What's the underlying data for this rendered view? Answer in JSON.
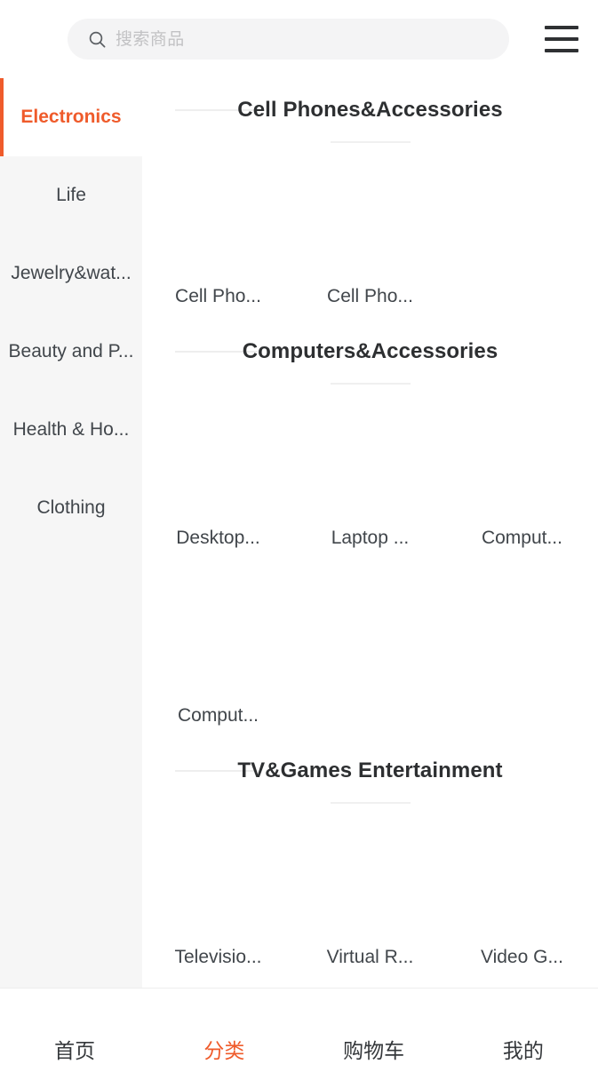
{
  "theme": {
    "accent": "#ef5b2b",
    "sidebar_bg": "#f6f6f6",
    "search_bg": "#f4f4f5",
    "text": "#41464b",
    "title_text": "#2d2f31"
  },
  "header": {
    "search": {
      "placeholder": "搜索商品",
      "value": "",
      "icon": "search-icon"
    },
    "menu_icon": "hamburger-menu-icon"
  },
  "sidebar": {
    "items": [
      {
        "label": "Electronics",
        "active": true
      },
      {
        "label": "Life",
        "active": false
      },
      {
        "label": "Jewelry&wat...",
        "active": false
      },
      {
        "label": "Beauty and P...",
        "active": false
      },
      {
        "label": "Health & Ho...",
        "active": false
      },
      {
        "label": "Clothing",
        "active": false
      }
    ]
  },
  "content": {
    "sections": [
      {
        "title": "Cell Phones&Accessories",
        "items": [
          {
            "label": "Cell Pho..."
          },
          {
            "label": "Cell Pho..."
          }
        ]
      },
      {
        "title": "Computers&Accessories",
        "items": [
          {
            "label": "Desktop..."
          },
          {
            "label": "Laptop ..."
          },
          {
            "label": "Comput..."
          },
          {
            "label": "Comput..."
          }
        ]
      },
      {
        "title": "TV&Games Entertainment",
        "items": [
          {
            "label": "Televisio..."
          },
          {
            "label": "Virtual R..."
          },
          {
            "label": "Video G..."
          }
        ]
      }
    ]
  },
  "tabbar": {
    "items": [
      {
        "label": "首页",
        "active": false
      },
      {
        "label": "分类",
        "active": true
      },
      {
        "label": "购物车",
        "active": false
      },
      {
        "label": "我的",
        "active": false
      }
    ]
  }
}
